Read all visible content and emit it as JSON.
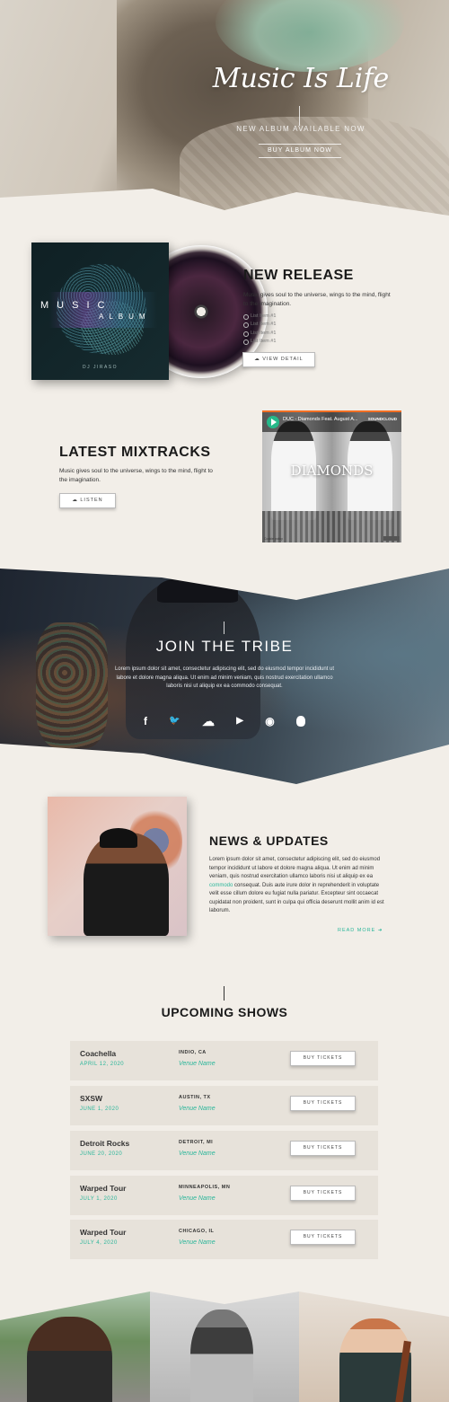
{
  "hero": {
    "title": "Music Is Life",
    "subtitle": "NEW ALBUM AVAILABLE NOW",
    "button_label": "BUY ALBUM NOW"
  },
  "new_release": {
    "cover_line1": "MUSIC",
    "cover_line2": "ALBUM",
    "cover_artist": "DJ JIRASO",
    "title": "NEW RELEASE",
    "description": "Music gives soul to the universe, wings to the mind, flight to the imagination.",
    "list_items": [
      "List Item #1",
      "List Item #1",
      "List Item #1",
      "List Item #1"
    ],
    "button_label": "VIEW DETAIL"
  },
  "mixtracks": {
    "title": "LATEST MIXTRACKS",
    "description": "Music gives soul to the universe, wings to the mind, flight to the imagination.",
    "button_label": "LISTEN",
    "player": {
      "track": "DUC - Diamonds Feat. August A...",
      "brand": "SOUNDCLOUD",
      "art_title": "DIAMONDS",
      "cookie_label": "Cookie policy"
    }
  },
  "tribe": {
    "title": "JOIN THE TRIBE",
    "description": "Lorem ipsum dolor sit amet, consectetur adipiscing elit, sed do eiusmod tempor incididunt ut labore et dolore magna aliqua. Ut enim ad minim veniam, quis nostrud exercitation ullamco laboris nisi ut aliquip ex ea commodo consequat.",
    "social": [
      {
        "icon": "facebook-icon",
        "glyph": "f"
      },
      {
        "icon": "twitter-icon",
        "glyph": "🐦"
      },
      {
        "icon": "soundcloud-icon",
        "glyph": "☁"
      },
      {
        "icon": "youtube-icon",
        "glyph": "▶"
      },
      {
        "icon": "spotify-icon",
        "glyph": "◉"
      },
      {
        "icon": "apple-icon",
        "glyph": ""
      }
    ]
  },
  "news": {
    "title": "NEWS & UPDATES",
    "body_before": "Lorem ipsum dolor sit amet, consectetur adipiscing elit, sed do eiusmod tempor incididunt ut labore et dolore magna aliqua. Ut enim ad minim veniam, quis nostrud exercitation ullamco laboris nisi ut aliquip ex ea ",
    "body_link": "commodo",
    "body_after": " consequat. Duis aute irure dolor in reprehenderit in voluptate velit esse cillum dolore eu fugiat nulla pariatur. Excepteur sint occaecat cupidatat non proident, sunt in culpa qui officia deserunt mollit anim id est laborum.",
    "read_more": "READ MORE ➜"
  },
  "shows": {
    "title": "UPCOMING SHOWS",
    "button_label": "BUY TICKETS",
    "rows": [
      {
        "name": "Coachella",
        "date": "APRIL 12, 2020",
        "city": "INDIO, CA",
        "venue": "Venue Name"
      },
      {
        "name": "SXSW",
        "date": "JUNE 1, 2020",
        "city": "AUSTIN, TX",
        "venue": "Venue Name"
      },
      {
        "name": "Detroit Rocks",
        "date": "JUNE 20, 2020",
        "city": "DETROIT, MI",
        "venue": "Venue Name"
      },
      {
        "name": "Warped Tour",
        "date": "JULY 1, 2020",
        "city": "MINNEAPOLIS, MN",
        "venue": "Venue Name"
      },
      {
        "name": "Warped Tour",
        "date": "JULY 4, 2020",
        "city": "CHICAGO, IL",
        "venue": "Venue Name"
      }
    ]
  },
  "colors": {
    "accent": "#2ab69a",
    "background": "#f2eee8",
    "player_accent": "#f26f23"
  }
}
